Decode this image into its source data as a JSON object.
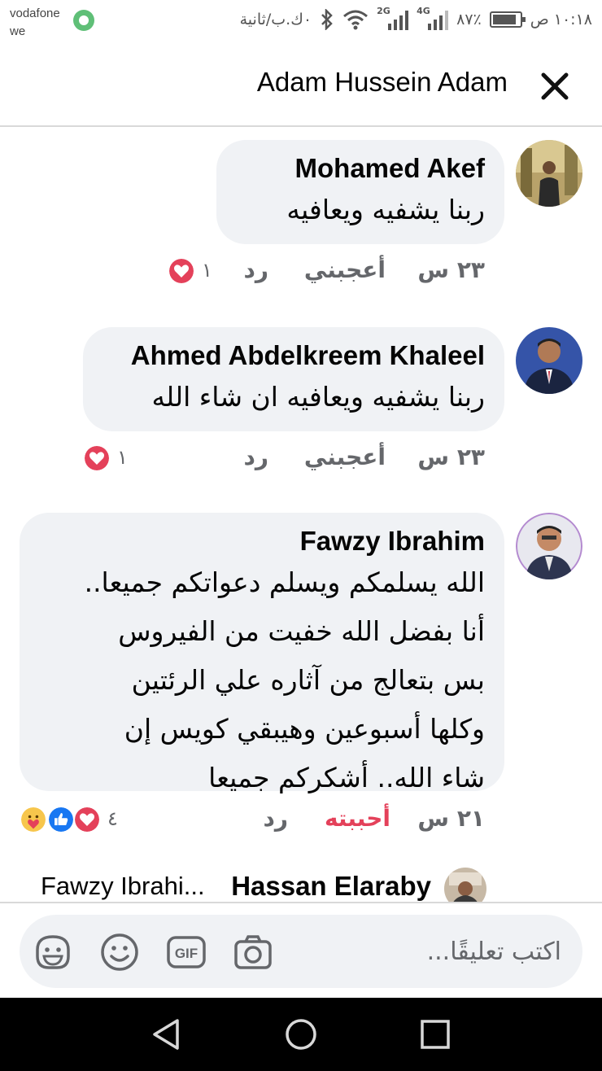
{
  "status_bar": {
    "carrier": [
      "vodafone",
      "we"
    ],
    "time": "١٠:١٨ ص",
    "battery": "٨٧٪",
    "data_speed": "٠ك.ب/ثانية",
    "sim1_network": "4G",
    "sim2_network": "2G"
  },
  "header": {
    "title": "Adam Hussein Adam"
  },
  "comments": [
    {
      "author": "Mohamed Akef",
      "lines": [
        "ربنا يشفيه ويعافيه"
      ],
      "time": "٢٣ س",
      "like_label": "أعجبني",
      "reply_label": "رد",
      "reaction_count": "١",
      "reactions": [
        "love"
      ]
    },
    {
      "author": "Ahmed Abdelkreem Khaleel",
      "lines": [
        "ربنا يشفيه ويعافيه ان شاء الله"
      ],
      "time": "٢٣ س",
      "like_label": "أعجبني",
      "reply_label": "رد",
      "reaction_count": "١",
      "reactions": [
        "love"
      ]
    },
    {
      "author": "Fawzy Ibrahim",
      "lines": [
        "الله يسلمكم ويسلم دعواتكم جميعا..",
        "أنا بفضل الله خفيت من الفيروس",
        "بس بتعالج من آثاره علي الرئتين",
        "وكلها أسبوعين وهيبقي كويس إن",
        "شاء الله.. أشكركم جميعا"
      ],
      "time": "٢١ س",
      "like_label": "أحببته",
      "reply_label": "رد",
      "reaction_count": "٤",
      "reactions": [
        "love",
        "like",
        "care"
      ]
    }
  ],
  "reply_preview": {
    "author": "Hassan Elaraby",
    "snippet": "Fawzy Ibrahi..."
  },
  "composer": {
    "placeholder": "اكتب تعليقًا..."
  },
  "colors": {
    "bubble": "#f0f2f5",
    "meta_text": "#65676b",
    "love_red": "#e4415a",
    "like_blue": "#1877f2"
  }
}
